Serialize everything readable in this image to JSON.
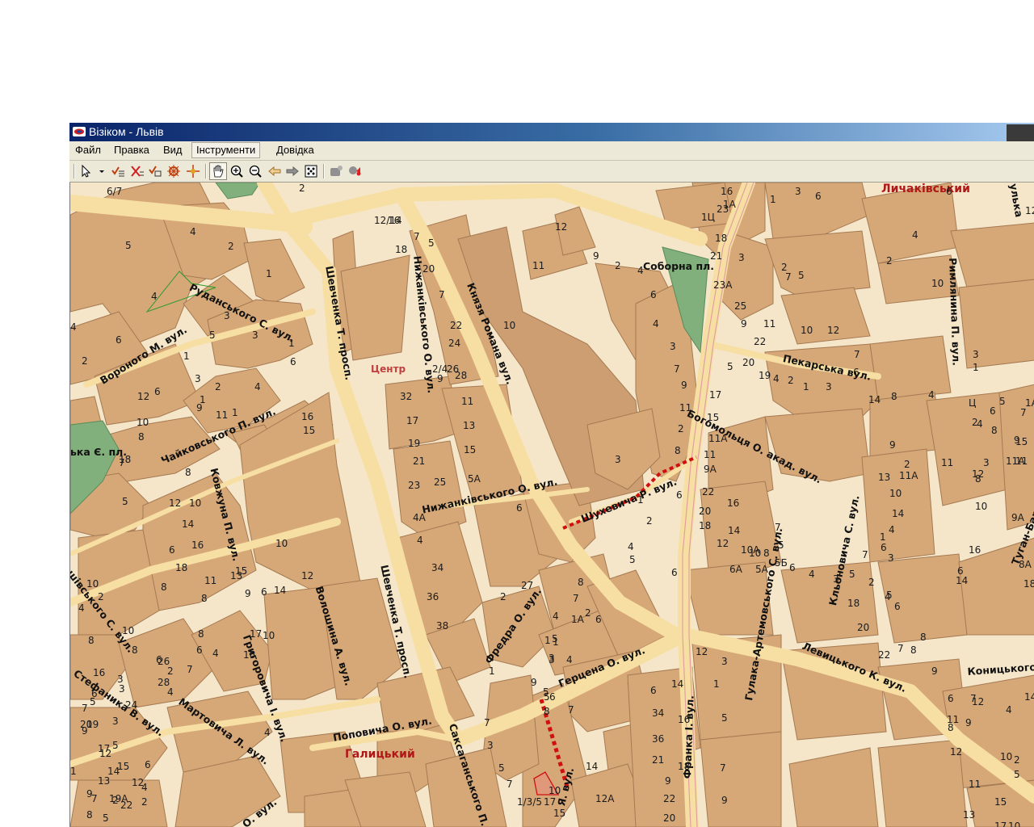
{
  "window": {
    "title": "Візіком - Львів"
  },
  "menu": [
    {
      "label": "Файл"
    },
    {
      "label": "Правка"
    },
    {
      "label": "Вид"
    },
    {
      "label": "Інструменти",
      "active": true
    },
    {
      "label": "Довідка"
    }
  ],
  "toolbar": {
    "tools": [
      "select-arrow-icon",
      "dropdown-arrow-icon",
      "select-layer-icon",
      "deselect-icon",
      "select-area-icon",
      "tools-icon",
      "settings-icon",
      "pan-hand-icon",
      "zoom-in-icon",
      "zoom-out-icon",
      "back-arrow-icon",
      "forward-arrow-icon",
      "full-extent-icon",
      "route-icon",
      "locate-marker-icon"
    ],
    "active_tool": "pan-hand-icon"
  },
  "map": {
    "districts": [
      {
        "label": "Личаківський"
      },
      {
        "label": "Галицький"
      }
    ],
    "places": [
      {
        "label": "Центр"
      },
      {
        "label": "Соборна пл."
      }
    ],
    "streets": [
      {
        "label": "Руданського С. вул."
      },
      {
        "label": "Вороного М. вул."
      },
      {
        "label": "Шевченка Т. просп."
      },
      {
        "label": "Нижанківського О. вул."
      },
      {
        "label": "Князя Романа вул."
      },
      {
        "label": "Пекарська вул."
      },
      {
        "label": "Римлянина П. вул."
      },
      {
        "label": "Богомольця О. акад. вул."
      },
      {
        "label": "Шухевича Р. вул."
      },
      {
        "label": "Нижанківського О. вул."
      },
      {
        "label": "Чайковського П. вул."
      },
      {
        "label": "Ковжуна П. вул."
      },
      {
        "label": "Шевченка Т. просп."
      },
      {
        "label": "Фредра О. вул."
      },
      {
        "label": "Волошина А. вул."
      },
      {
        "label": "Григоровича І. вул."
      },
      {
        "label": "Стефаника В. вул."
      },
      {
        "label": "Мартовича Л. вул."
      },
      {
        "label": "Поповича О. вул."
      },
      {
        "label": "Герцена О. вул."
      },
      {
        "label": "Саксаганського П."
      },
      {
        "label": "Франка І. вул."
      },
      {
        "label": "Гулака-Артемовського С. вул."
      },
      {
        "label": "Кльоновича С. вул."
      },
      {
        "label": "Левицького К. вул."
      },
      {
        "label": "Коницького"
      },
      {
        "label": "Туган-Барановського"
      },
      {
        "label": "ька Є. пл."
      },
      {
        "label": "ашівського С. вул."
      },
      {
        "label": "О. вул."
      },
      {
        "label": "Я. вул."
      },
      {
        "label": "улька"
      }
    ],
    "house_numbers": [
      "6/7",
      "2",
      "5",
      "4",
      "2",
      "1",
      "4",
      "4",
      "6",
      "2",
      "1",
      "3",
      "3",
      "5",
      "1",
      "6",
      "3",
      "1",
      "2",
      "9",
      "11",
      "1",
      "4",
      "16",
      "6",
      "12",
      "10",
      "8",
      "18",
      "5",
      "7",
      "8",
      "10",
      "12",
      "14",
      "16",
      "18",
      "11",
      "13",
      "8",
      "15",
      "9",
      "17",
      "10",
      "14",
      "12",
      "10",
      "8",
      "6",
      "4",
      "16",
      "7",
      "6",
      "2",
      "4",
      "3",
      "5",
      "1",
      "6",
      "4",
      "2",
      "7",
      "9",
      "5",
      "8",
      "22",
      "24",
      "26",
      "28",
      "20",
      "19",
      "17",
      "15",
      "19А",
      "12",
      "10",
      "8",
      "6",
      "8",
      "10",
      "4",
      "2",
      "8",
      "16",
      "6",
      "5",
      "7",
      "3",
      "3",
      "9",
      "14",
      "13",
      "12",
      "2",
      "4",
      "6",
      "15",
      "12/14",
      "16",
      "7",
      "18",
      "20",
      "5",
      "7",
      "22",
      "24",
      "26",
      "28",
      "2/4",
      "9",
      "11",
      "13",
      "15",
      "5А",
      "32",
      "17",
      "19",
      "21",
      "23",
      "25",
      "6",
      "4А",
      "4",
      "34",
      "36",
      "38",
      "1",
      "2",
      "27",
      "7",
      "1А",
      "6",
      "4",
      "2",
      "1",
      "3",
      "5",
      "7",
      "9",
      "1",
      "3",
      "4",
      "5",
      "6",
      "8",
      "7",
      "3",
      "5",
      "7",
      "10",
      "17",
      "1/3/5",
      "15",
      "14",
      "12А",
      "12",
      "11",
      "10",
      "9",
      "2",
      "4",
      "6",
      "4",
      "3",
      "7",
      "9",
      "11",
      "2",
      "8",
      "3",
      "1",
      "2",
      "6",
      "4",
      "5",
      "6",
      "3",
      "6",
      "2",
      "7",
      "1",
      "1А",
      "1Ц",
      "3",
      "5",
      "9",
      "11",
      "10",
      "12",
      "7",
      "6",
      "5",
      "4",
      "2",
      "1",
      "3",
      "14",
      "8",
      "6",
      "4",
      "2",
      "12",
      "10",
      "1",
      "3",
      "5",
      "7",
      "9",
      "11",
      "1А",
      "Ц",
      "2",
      "4",
      "6",
      "8",
      "3",
      "11А",
      "15",
      "9А",
      "8А",
      "18",
      "16",
      "14",
      "12",
      "10",
      "8",
      "6",
      "4",
      "9",
      "11",
      "11А",
      "13",
      "10",
      "14",
      "4",
      "6",
      "18",
      "20",
      "22",
      "2",
      "1",
      "3",
      "5",
      "7",
      "8",
      "9",
      "11",
      "13",
      "15",
      "17",
      "10",
      "8",
      "6",
      "12",
      "4",
      "2",
      "5",
      "7",
      "9",
      "11",
      "10",
      "12",
      "14",
      "16",
      "23",
      "18",
      "21",
      "23А",
      "25",
      "22",
      "20",
      "19",
      "17",
      "15",
      "11А",
      "11",
      "9А",
      "22",
      "20",
      "18",
      "16",
      "14",
      "12",
      "10А",
      "10",
      "8",
      "7",
      "5",
      "6А",
      "5А",
      "5Б",
      "6",
      "4",
      "3",
      "5",
      "7",
      "2",
      "4",
      "6",
      "8",
      "1",
      "3",
      "5",
      "7",
      "9",
      "12",
      "14",
      "16",
      "18",
      "20",
      "22",
      "9",
      "21",
      "36",
      "34",
      "6",
      "8",
      "5"
    ]
  }
}
